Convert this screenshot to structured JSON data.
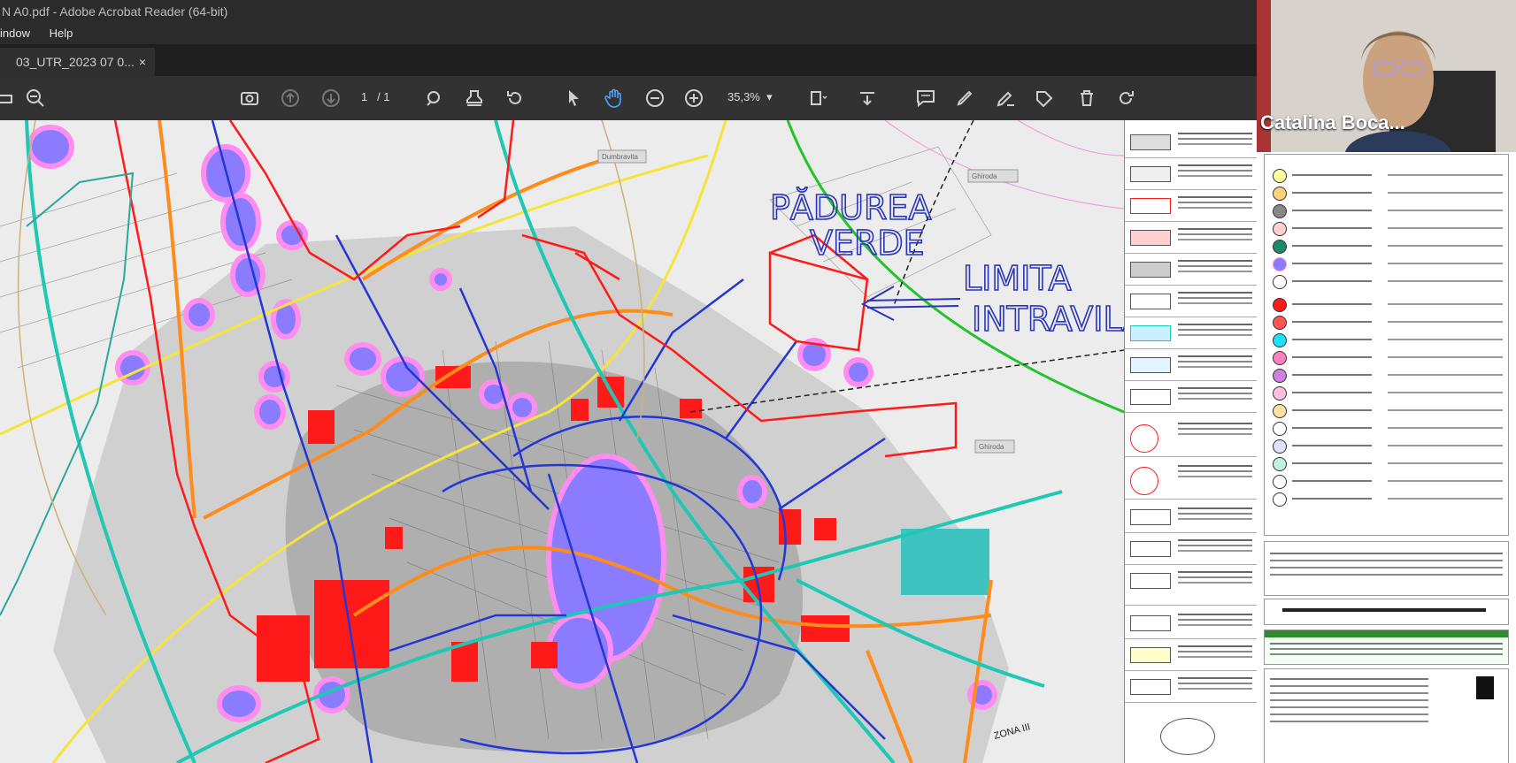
{
  "window": {
    "title": "N A0.pdf - Adobe Acrobat Reader (64-bit)",
    "menu": [
      "indow",
      "Help"
    ]
  },
  "tab": {
    "label": "03_UTR_2023 07 0...",
    "close": "×"
  },
  "toolbar": {
    "page_current": "1",
    "page_total": "/ 1",
    "zoom": "35,3%",
    "icons": [
      "print-icon",
      "zoom-out-magnifier-icon",
      "snapshot-icon",
      "previous-page-icon",
      "next-page-icon",
      "marquee-zoom-icon",
      "stamp-icon",
      "rotate-icon",
      "select-arrow-icon",
      "hand-tool-icon",
      "zoom-out-icon",
      "zoom-in-icon",
      "fit-page-icon",
      "scroll-icon",
      "comment-icon",
      "highlight-icon",
      "sign-icon",
      "edit-icon",
      "delete-icon",
      "redo-icon"
    ]
  },
  "map": {
    "annotations": {
      "line1": "PĂDUREA",
      "line2": "VERDE",
      "line3": "LIMITA",
      "line4": "INTRAVILAN"
    },
    "labels": {
      "north": "Dumbravita",
      "east_top": "Ghiroda",
      "east": "Ghiroda",
      "zone": "ZONA III"
    },
    "colors": {
      "red": "#ff1a1a",
      "blue": "#2336d6",
      "purple": "#8a7bff",
      "pink": "#ff8cf0",
      "yellow": "#f7e43a",
      "orange": "#ff8c1a",
      "teal": "#1fc7b5",
      "green": "#23c32a"
    }
  },
  "webcam": {
    "name": "Catalina Boca..."
  }
}
